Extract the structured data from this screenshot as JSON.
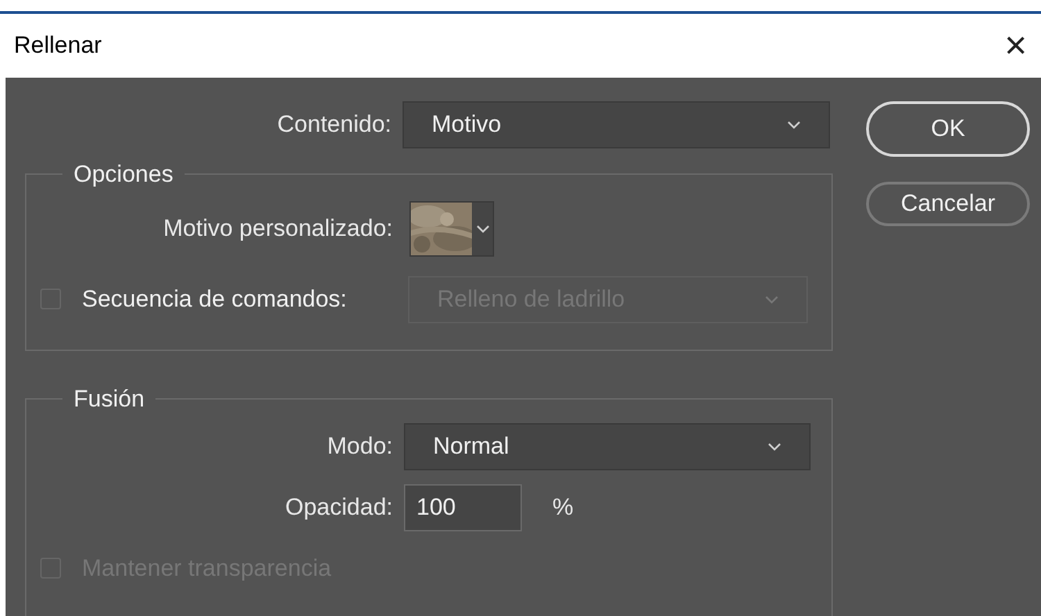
{
  "window": {
    "title": "Rellenar",
    "close": "×"
  },
  "content": {
    "label": "Contenido:",
    "value": "Motivo"
  },
  "buttons": [
    {
      "label": "OK",
      "kind": "default"
    },
    {
      "label": "Cancelar",
      "kind": "normal"
    }
  ],
  "options": {
    "legend": "Opciones",
    "custom_pattern": {
      "label": "Motivo personalizado:"
    },
    "script": {
      "label": "Secuencia de comandos:",
      "checked": false,
      "value": "Relleno de ladrillo",
      "disabled": true
    }
  },
  "blending": {
    "legend": "Fusión",
    "mode": {
      "label": "Modo:",
      "value": "Normal"
    },
    "opacity": {
      "label": "Opacidad:",
      "value": "100",
      "unit": "%"
    },
    "preserve": {
      "label": "Mantener transparencia",
      "checked": false,
      "disabled": true
    }
  }
}
